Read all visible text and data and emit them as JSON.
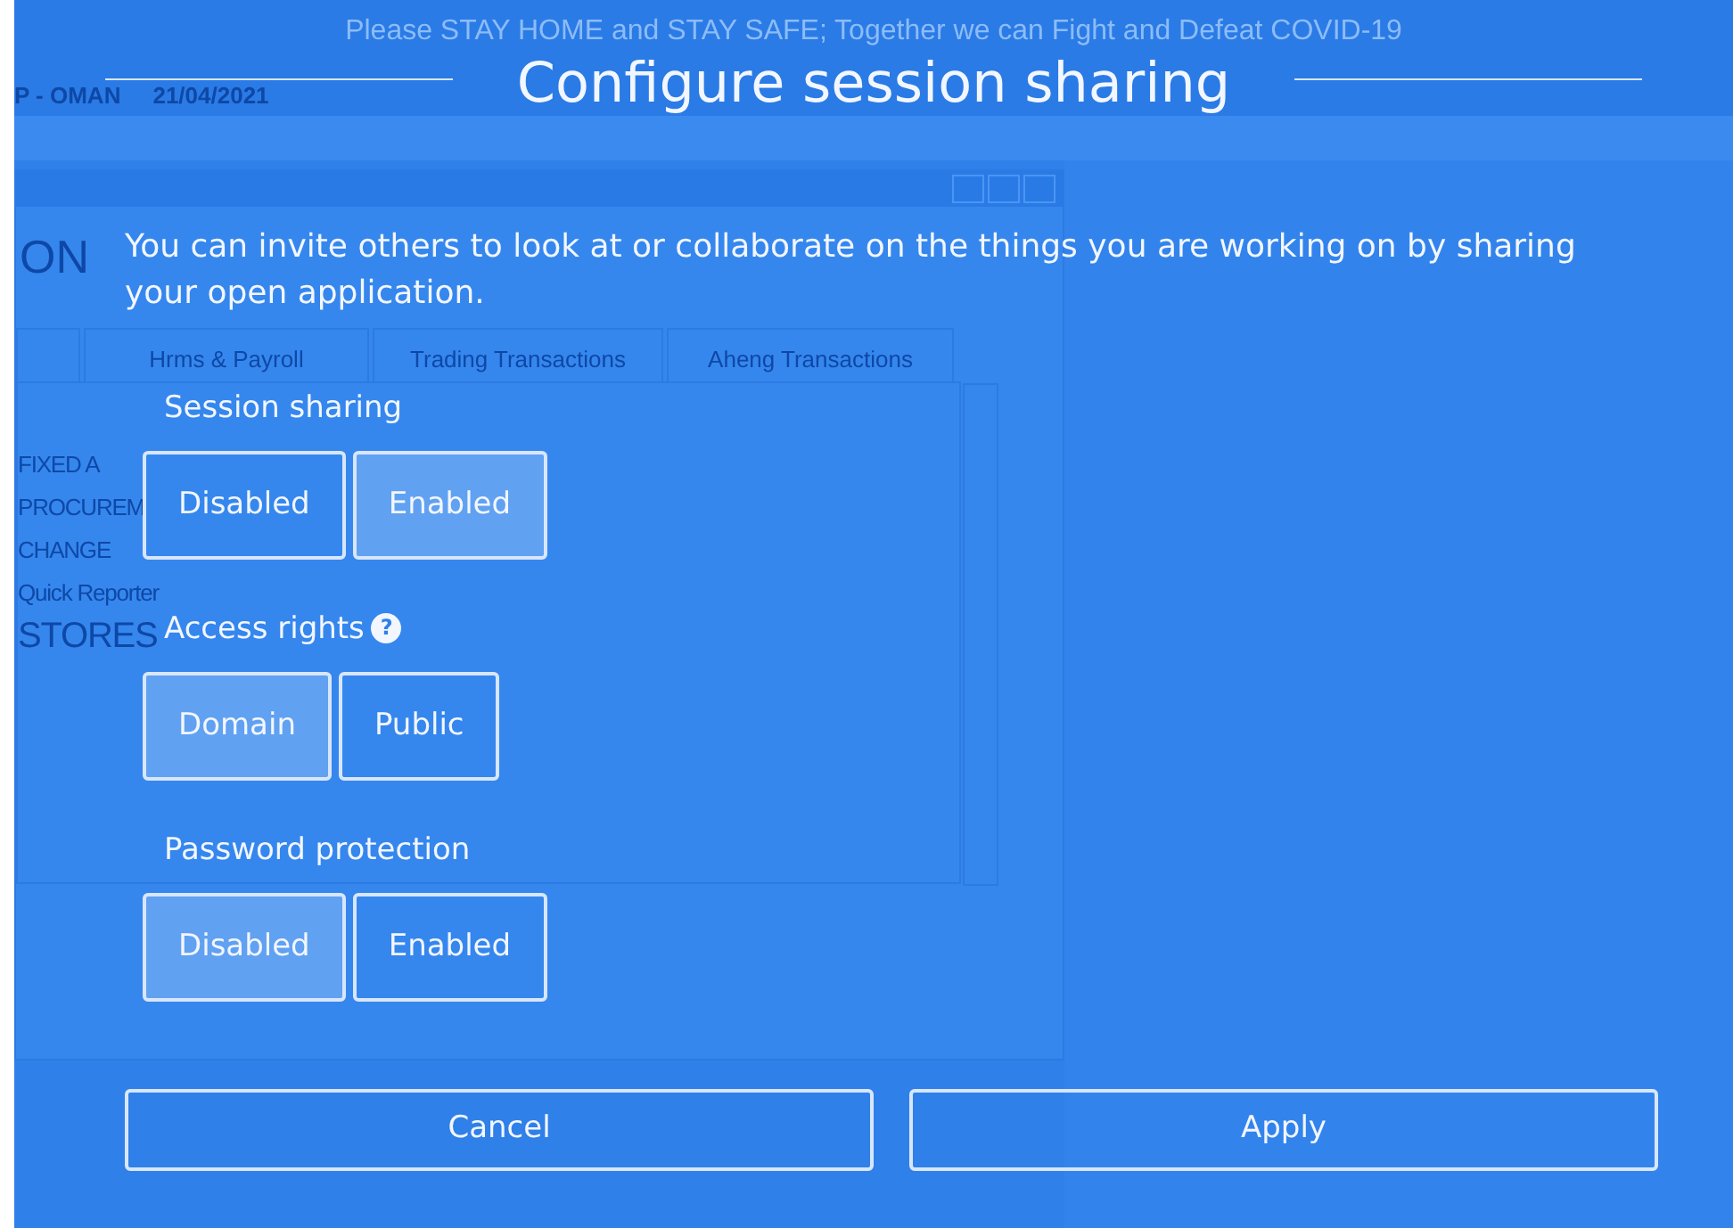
{
  "background_app": {
    "banner": "Please STAY HOME and STAY SAFE; Together we can Fight and Defeat COVID-19",
    "company": "P - OMAN",
    "date": "21/04/2021",
    "logo": "ON",
    "tabs": [
      "Hrms & Payroll",
      "Trading Transactions",
      "Aheng Transactions"
    ],
    "menu": [
      "FIXED A",
      "PROCUREM",
      "CHANGE",
      "Quick  Reporter",
      "STORES"
    ]
  },
  "dialog": {
    "title": "Configure session sharing",
    "description": "You can invite others to look at or collaborate on the things you are working on by sharing your open application.",
    "sections": [
      {
        "label": "Session sharing",
        "options": [
          {
            "label": "Disabled",
            "selected": false
          },
          {
            "label": "Enabled",
            "selected": true
          }
        ]
      },
      {
        "label": "Access rights",
        "help": "?",
        "options": [
          {
            "label": "Domain",
            "selected": true
          },
          {
            "label": "Public",
            "selected": false
          }
        ]
      },
      {
        "label": "Password protection",
        "options": [
          {
            "label": "Disabled",
            "selected": true
          },
          {
            "label": "Enabled",
            "selected": false
          }
        ]
      }
    ],
    "buttons": [
      "Cancel",
      "Apply"
    ]
  }
}
